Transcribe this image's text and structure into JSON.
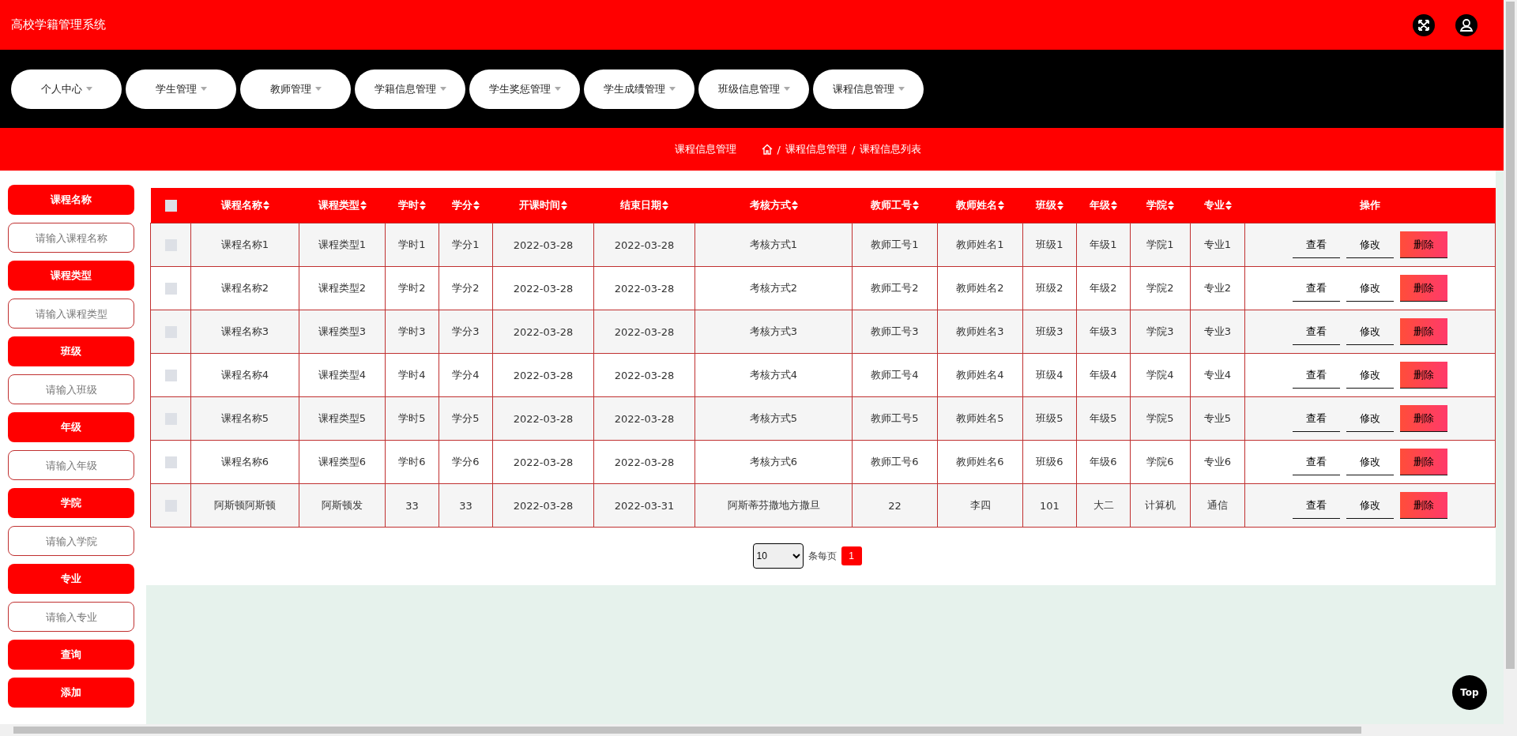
{
  "app_title": "高校学籍管理系统",
  "nav": [
    {
      "label": "个人中心",
      "has_dropdown": true
    },
    {
      "label": "学生管理",
      "has_dropdown": true
    },
    {
      "label": "教师管理",
      "has_dropdown": true
    },
    {
      "label": "学籍信息管理",
      "has_dropdown": true
    },
    {
      "label": "学生奖惩管理",
      "has_dropdown": true
    },
    {
      "label": "学生成绩管理",
      "has_dropdown": true
    },
    {
      "label": "班级信息管理",
      "has_dropdown": true
    },
    {
      "label": "课程信息管理",
      "has_dropdown": true
    }
  ],
  "page_title": "课程信息管理",
  "breadcrumb": [
    {
      "label": "课程信息管理",
      "separator": "/"
    },
    {
      "label": "课程信息列表",
      "separator": "/"
    }
  ],
  "filters": [
    {
      "label": "课程名称",
      "placeholder": "请输入课程名称"
    },
    {
      "label": "课程类型",
      "placeholder": "请输入课程类型"
    },
    {
      "label": "班级",
      "placeholder": "请输入班级"
    },
    {
      "label": "年级",
      "placeholder": "请输入年级"
    },
    {
      "label": "学院",
      "placeholder": "请输入学院"
    },
    {
      "label": "专业",
      "placeholder": "请输入专业"
    }
  ],
  "filter_buttons": [
    "查询",
    "添加"
  ],
  "table": {
    "select_all_checked": false,
    "columns": [
      {
        "label": "课程名称",
        "sortable": true
      },
      {
        "label": "课程类型",
        "sortable": true
      },
      {
        "label": "学时",
        "sortable": true
      },
      {
        "label": "学分",
        "sortable": true
      },
      {
        "label": "开课时间",
        "sortable": true
      },
      {
        "label": "结束日期",
        "sortable": true
      },
      {
        "label": "考核方式",
        "sortable": true
      },
      {
        "label": "教师工号",
        "sortable": true
      },
      {
        "label": "教师姓名",
        "sortable": true
      },
      {
        "label": "班级",
        "sortable": true
      },
      {
        "label": "年级",
        "sortable": true
      },
      {
        "label": "学院",
        "sortable": true
      },
      {
        "label": "专业",
        "sortable": true
      },
      {
        "label": "操作",
        "sortable": false
      }
    ],
    "rows": [
      {
        "checked": false,
        "cells": [
          "课程名称1",
          "课程类型1",
          "学时1",
          "学分1",
          "2022-03-28",
          "2022-03-28",
          "考核方式1",
          "教师工号1",
          "教师姓名1",
          "班级1",
          "年级1",
          "学院1",
          "专业1"
        ],
        "actions": [
          "查看",
          "修改",
          "删除"
        ]
      },
      {
        "checked": false,
        "cells": [
          "课程名称2",
          "课程类型2",
          "学时2",
          "学分2",
          "2022-03-28",
          "2022-03-28",
          "考核方式2",
          "教师工号2",
          "教师姓名2",
          "班级2",
          "年级2",
          "学院2",
          "专业2"
        ],
        "actions": [
          "查看",
          "修改",
          "删除"
        ]
      },
      {
        "checked": false,
        "cells": [
          "课程名称3",
          "课程类型3",
          "学时3",
          "学分3",
          "2022-03-28",
          "2022-03-28",
          "考核方式3",
          "教师工号3",
          "教师姓名3",
          "班级3",
          "年级3",
          "学院3",
          "专业3"
        ],
        "actions": [
          "查看",
          "修改",
          "删除"
        ]
      },
      {
        "checked": false,
        "cells": [
          "课程名称4",
          "课程类型4",
          "学时4",
          "学分4",
          "2022-03-28",
          "2022-03-28",
          "考核方式4",
          "教师工号4",
          "教师姓名4",
          "班级4",
          "年级4",
          "学院4",
          "专业4"
        ],
        "actions": [
          "查看",
          "修改",
          "删除"
        ]
      },
      {
        "checked": false,
        "cells": [
          "课程名称5",
          "课程类型5",
          "学时5",
          "学分5",
          "2022-03-28",
          "2022-03-28",
          "考核方式5",
          "教师工号5",
          "教师姓名5",
          "班级5",
          "年级5",
          "学院5",
          "专业5"
        ],
        "actions": [
          "查看",
          "修改",
          "删除"
        ]
      },
      {
        "checked": false,
        "cells": [
          "课程名称6",
          "课程类型6",
          "学时6",
          "学分6",
          "2022-03-28",
          "2022-03-28",
          "考核方式6",
          "教师工号6",
          "教师姓名6",
          "班级6",
          "年级6",
          "学院6",
          "专业6"
        ],
        "actions": [
          "查看",
          "修改",
          "删除"
        ]
      },
      {
        "checked": false,
        "cells": [
          "阿斯顿阿斯顿",
          "阿斯顿发",
          "33",
          "33",
          "2022-03-28",
          "2022-03-31",
          "阿斯蒂芬撒地方撒旦",
          "22",
          "李四",
          "101",
          "大二",
          "计算机",
          "通信"
        ],
        "actions": [
          "查看",
          "修改",
          "删除"
        ]
      }
    ]
  },
  "pagination": {
    "page_size": "10",
    "per_page_label": "条每页",
    "pages": [
      {
        "label": "1",
        "selected": true
      }
    ]
  },
  "top_button": "Top"
}
